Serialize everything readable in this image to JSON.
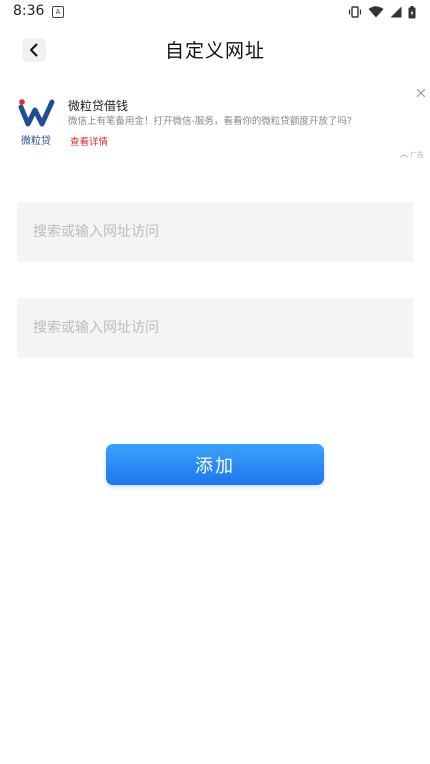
{
  "status_bar": {
    "time": "8:36",
    "notification_icon": "A"
  },
  "header": {
    "title": "自定义网址"
  },
  "ad": {
    "logo_caption": "微粒贷",
    "title": "微粒贷借钱",
    "description": "微信上有笔备用金！打开微信-服务，看看你的微粒贷额度开放了吗?",
    "link_label": "查看详情",
    "badge_label": "广告"
  },
  "form": {
    "url_field_1_placeholder": "搜索或输入网址访问",
    "url_field_2_placeholder": "搜索或输入网址访问",
    "add_button_label": "添加"
  },
  "colors": {
    "button_gradient_top": "#3aa2fb",
    "button_gradient_bottom": "#1e76ee",
    "ad_link": "#e0282e",
    "logo_blue": "#1e4e96",
    "logo_red": "#e0282e"
  }
}
